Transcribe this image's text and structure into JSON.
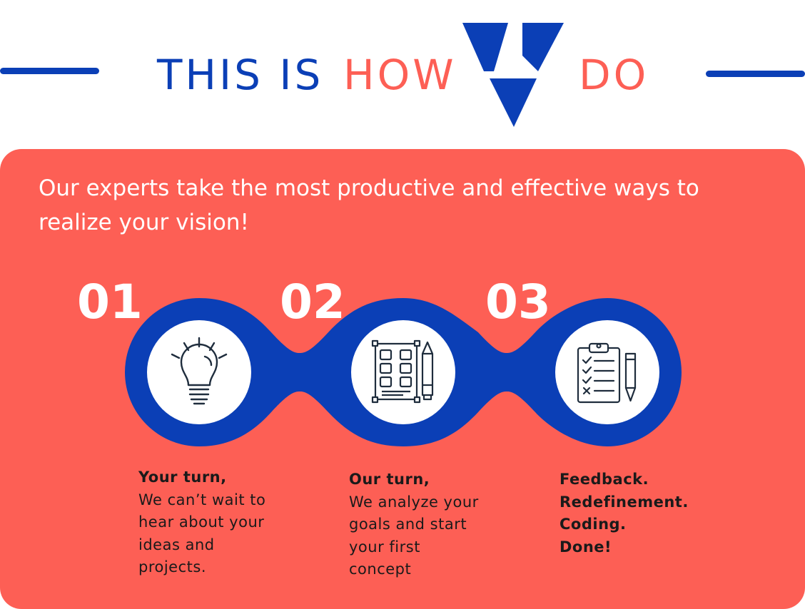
{
  "header": {
    "title_part1": "THIS IS",
    "title_part2": "HOW",
    "title_part4": "DO",
    "logo_icon": "v-logo-icon",
    "colors": {
      "blue": "#0b3fb6",
      "coral": "#fd5f55"
    }
  },
  "panel": {
    "background_color": "#fd5f55",
    "intro": "Our experts take the most productive and effective ways to realize your vision!"
  },
  "process": {
    "chain_color": "#0b3fb6",
    "steps": [
      {
        "number": "01",
        "icon": "lightbulb-icon",
        "heading": "Your turn,",
        "lines": [
          "We can’t wait to",
          "hear about your",
          "ideas and",
          "projects."
        ]
      },
      {
        "number": "02",
        "icon": "wireframe-pencil-icon",
        "heading": "Our turn,",
        "lines": [
          "We analyze your",
          "goals and start",
          "your first",
          "concept"
        ]
      },
      {
        "number": "03",
        "icon": "checklist-pencil-icon",
        "heading_lines": [
          "Feedback.",
          "Redefinement.",
          "Coding.",
          "Done!"
        ]
      }
    ]
  }
}
